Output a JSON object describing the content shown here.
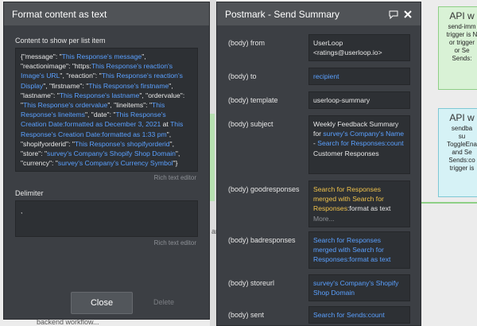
{
  "background": {
    "cards": [
      {
        "title": "API w",
        "lines": [
          "send-imm",
          "trigger is N",
          "or trigger",
          "or Se",
          "Sends:"
        ]
      },
      {
        "title": "API w",
        "lines": [
          "sendba",
          "su",
          "ToggleEna",
          "and Se",
          "Sends:co",
          "trigger is"
        ]
      }
    ],
    "canvas_labels": [
      "backend workflow...",
      "ar"
    ]
  },
  "left_panel": {
    "title": "Format content as text",
    "content_label": "Content to show per list item",
    "content_segments": [
      {
        "t": "{\"message\": \"",
        "d": false
      },
      {
        "t": "This Response's message",
        "d": true
      },
      {
        "t": "\", \"reactionimage\": \"https:",
        "d": false
      },
      {
        "t": "This Response's reaction's Image's URL",
        "d": true
      },
      {
        "t": "\", \"reaction\": \"",
        "d": false
      },
      {
        "t": "This Response's reaction's Display",
        "d": true
      },
      {
        "t": "\", \"firstname\": \"",
        "d": false
      },
      {
        "t": "This Response's firstname",
        "d": true
      },
      {
        "t": "\", \"lastname\": \"",
        "d": false
      },
      {
        "t": "This Response's lastname",
        "d": true
      },
      {
        "t": "\", \"ordervalue\": \"",
        "d": false
      },
      {
        "t": "This Response's ordervalue",
        "d": true
      },
      {
        "t": "\", \"lineitems\": \"",
        "d": false
      },
      {
        "t": "This Response's lineitems",
        "d": true
      },
      {
        "t": "\", \"date\": \"",
        "d": false
      },
      {
        "t": "This Response's Creation Date:formatted as December 3, 2021",
        "d": true
      },
      {
        "t": " at ",
        "d": false
      },
      {
        "t": "This Response's Creation Date:formatted as 1:33 pm",
        "d": true
      },
      {
        "t": "\", \"shopifyorderid\": \"",
        "d": false
      },
      {
        "t": "This Response's shopifyorderid",
        "d": true
      },
      {
        "t": "\", \"store\": \"",
        "d": false
      },
      {
        "t": "survey's Company's Shopify Shop Domain",
        "d": true
      },
      {
        "t": "\", \"currency\": \"",
        "d": false
      },
      {
        "t": "survey's Company's Currency Symbol",
        "d": true
      },
      {
        "t": "\"}",
        "d": false
      }
    ],
    "rich_text_label_1": "Rich text editor",
    "delimiter_label": "Delimiter",
    "delimiter_value": ",",
    "rich_text_label_2": "Rich text editor",
    "close_label": "Close",
    "delete_label": "Delete"
  },
  "right_panel": {
    "title": "Postmark - Send Summary",
    "rows": [
      {
        "label": "(body) from",
        "segments": [
          {
            "t": "UserLoop <ratings@userloop.io>",
            "c": "plain"
          }
        ]
      },
      {
        "label": "(body) to",
        "segments": [
          {
            "t": " recipient",
            "c": "dyn"
          }
        ]
      },
      {
        "label": "(body) template",
        "segments": [
          {
            "t": "userloop-summary",
            "c": "plain"
          }
        ]
      },
      {
        "label": "(body) subject",
        "segments": [
          {
            "t": "Weekly Feedback Summary for ",
            "c": "plain"
          },
          {
            "t": "survey's Company's Name",
            "c": "dyn"
          },
          {
            "t": " - ",
            "c": "plain"
          },
          {
            "t": "Search for Responses:count",
            "c": "dyn"
          },
          {
            "t": " Customer Responses",
            "c": "plain"
          }
        ]
      },
      {
        "label": "(body) goodresponses",
        "segments": [
          {
            "t": " Search for Responses merged with Search for Responses",
            "c": "dyn-y"
          },
          {
            "t": ":format as text",
            "c": "plain"
          },
          {
            "t": "\nMore...",
            "c": "more"
          }
        ]
      },
      {
        "label": "(body) badresponses",
        "segments": [
          {
            "t": " Search for Responses merged with Search for Responses:format as text",
            "c": "dyn"
          }
        ]
      },
      {
        "label": "(body) storeurl",
        "segments": [
          {
            "t": " survey's Company's Shopify Shop Domain",
            "c": "dyn"
          }
        ]
      },
      {
        "label": "(body) sent",
        "segments": [
          {
            "t": " Search for Sends:count",
            "c": "dyn"
          }
        ]
      }
    ]
  },
  "colors": {
    "panel_bg": "#3c3f44",
    "header_bg": "#505357",
    "field_bg": "#2d3034",
    "dynamic_blue": "#5aa0ff",
    "dynamic_yellow": "#f0c24b"
  }
}
